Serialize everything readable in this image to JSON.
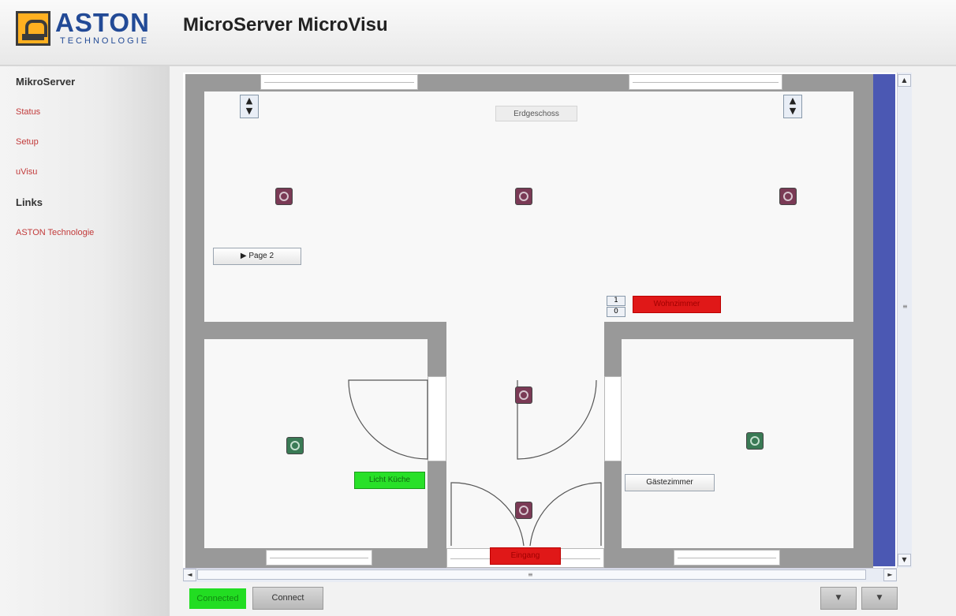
{
  "header": {
    "logo_name": "ASTON",
    "logo_sub": "TECHNOLOGIE",
    "title": "MicroServer MicroVisu"
  },
  "sidebar": {
    "heading_main": "MikroServer",
    "items": [
      {
        "label": "Status"
      },
      {
        "label": "Setup"
      },
      {
        "label": "uVisu"
      }
    ],
    "heading_links": "Links",
    "links": [
      {
        "label": "ASTON Technologie"
      }
    ]
  },
  "plan": {
    "floor_label": "Erdgeschoss",
    "page_button": "▶ Page 2",
    "alarm_label": "Wohnzimmer",
    "kitchen_light": "Licht Küche",
    "guest_room": "Gästezimmer",
    "entrance_label": "Eingang",
    "spin_up": "1",
    "spin_down": "0",
    "colors": {
      "wall": "#999999",
      "active_on": "#28e028",
      "active_off": "#e01818",
      "lamp_off": "#7a3a55",
      "lamp_on": "#3a7a55",
      "scroll_thumb": "#4b58b3"
    }
  },
  "scrollbars": {
    "up": "▲",
    "down": "▼",
    "left": "◄",
    "right": "►",
    "grip": "≡"
  },
  "toolbar": {
    "status": "Connected",
    "connect_label": "Connect",
    "btn1": "▼",
    "btn2": "▼"
  }
}
